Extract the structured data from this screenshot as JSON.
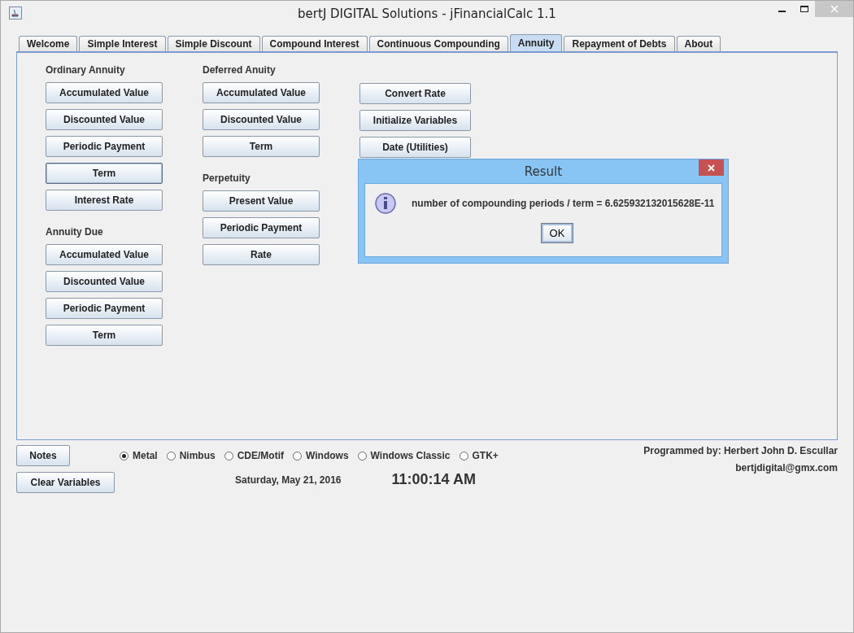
{
  "window": {
    "title": "bertJ DIGITAL Solutions - jFinancialCalc 1.1"
  },
  "tabs": [
    {
      "label": "Welcome",
      "selected": false
    },
    {
      "label": "Simple Interest",
      "selected": false
    },
    {
      "label": "Simple Discount",
      "selected": false
    },
    {
      "label": "Compound Interest",
      "selected": false
    },
    {
      "label": "Continuous Compounding",
      "selected": false
    },
    {
      "label": "Annuity",
      "selected": true
    },
    {
      "label": "Repayment of Debts",
      "selected": false
    },
    {
      "label": "About",
      "selected": false
    }
  ],
  "columns": [
    {
      "sections": [
        {
          "heading": "Ordinary Annuity",
          "buttons": [
            {
              "label": "Accumulated Value",
              "focused": false
            },
            {
              "label": "Discounted Value",
              "focused": false
            },
            {
              "label": "Periodic Payment",
              "focused": false
            },
            {
              "label": "Term",
              "focused": true
            },
            {
              "label": "Interest Rate",
              "focused": false
            }
          ]
        },
        {
          "heading": "Annuity Due",
          "buttons": [
            {
              "label": "Accumulated Value",
              "focused": false
            },
            {
              "label": "Discounted Value",
              "focused": false
            },
            {
              "label": "Periodic Payment",
              "focused": false
            },
            {
              "label": "Term",
              "focused": false
            }
          ]
        }
      ]
    },
    {
      "sections": [
        {
          "heading": "Deferred Anuity",
          "buttons": [
            {
              "label": "Accumulated Value",
              "focused": false
            },
            {
              "label": "Discounted Value",
              "focused": false
            },
            {
              "label": "Term",
              "focused": false
            }
          ]
        },
        {
          "heading": "Perpetuity",
          "buttons": [
            {
              "label": "Present Value",
              "focused": false
            },
            {
              "label": "Periodic Payment",
              "focused": false
            },
            {
              "label": "Rate",
              "focused": false
            }
          ]
        }
      ]
    },
    {
      "sections": [
        {
          "buttons": [
            {
              "label": "Convert Rate",
              "focused": false
            },
            {
              "label": "Initialize Variables",
              "focused": false
            },
            {
              "label": "Date (Utilities)",
              "focused": false
            }
          ]
        }
      ]
    }
  ],
  "dialog": {
    "title": "Result",
    "message": "number of compounding periods / term = 6.625932132015628E-11",
    "button": "OK"
  },
  "footer": {
    "notes_button": "Notes",
    "clear_button": "Clear Variables",
    "look_and_feel": [
      {
        "label": "Metal",
        "selected": true
      },
      {
        "label": "Nimbus",
        "selected": false
      },
      {
        "label": "CDE/Motif",
        "selected": false
      },
      {
        "label": "Windows",
        "selected": false
      },
      {
        "label": "Windows Classic",
        "selected": false
      },
      {
        "label": "GTK+",
        "selected": false
      }
    ],
    "date": "Saturday, May 21, 2016",
    "time": "11:00:14 AM",
    "author": "Programmed by: Herbert John D. Escullar",
    "email": "bertjdigital@gmx.com"
  }
}
